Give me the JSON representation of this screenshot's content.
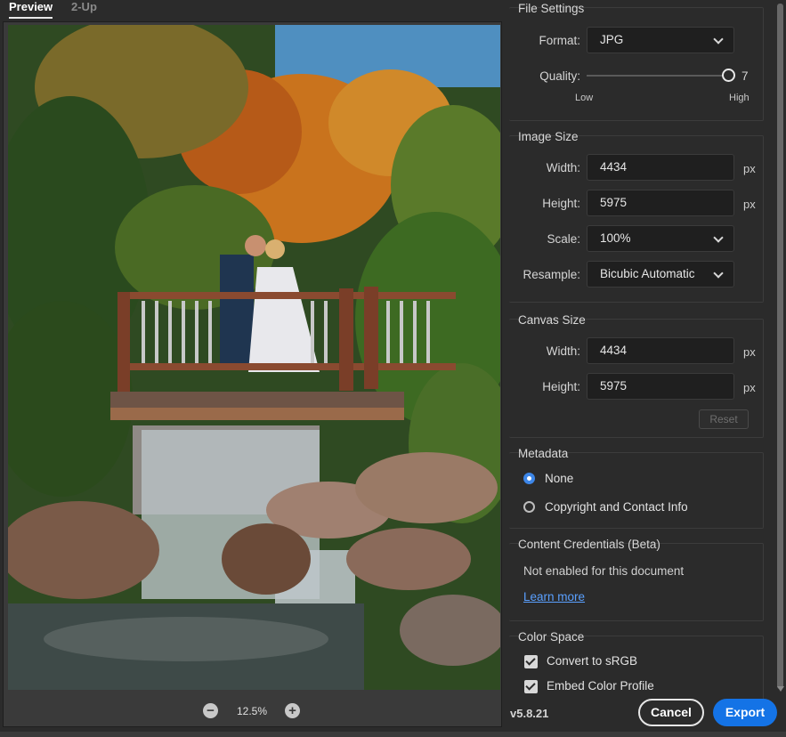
{
  "tabs": {
    "preview": "Preview",
    "two_up": "2-Up"
  },
  "zoom": {
    "level": "12.5%",
    "minus": "−",
    "plus": "+"
  },
  "file_settings": {
    "title": "File Settings",
    "format_label": "Format:",
    "format_value": "JPG",
    "quality_label": "Quality:",
    "quality_value": "7",
    "quality_low": "Low",
    "quality_high": "High"
  },
  "image_size": {
    "title": "Image Size",
    "width_label": "Width:",
    "width_value": "4434",
    "height_label": "Height:",
    "height_value": "5975",
    "unit": "px",
    "scale_label": "Scale:",
    "scale_value": "100%",
    "resample_label": "Resample:",
    "resample_value": "Bicubic Automatic"
  },
  "canvas_size": {
    "title": "Canvas Size",
    "width_label": "Width:",
    "width_value": "4434",
    "height_label": "Height:",
    "height_value": "5975",
    "unit": "px",
    "reset_label": "Reset"
  },
  "metadata": {
    "title": "Metadata",
    "option_none": "None",
    "option_copyright": "Copyright and Contact Info"
  },
  "content_credentials": {
    "title": "Content Credentials (Beta)",
    "status": "Not enabled for this document",
    "link": "Learn more"
  },
  "color_space": {
    "title": "Color Space",
    "convert_label": "Convert to sRGB",
    "embed_label": "Embed Color Profile"
  },
  "footer": {
    "version": "v5.8.21",
    "cancel": "Cancel",
    "export": "Export"
  }
}
